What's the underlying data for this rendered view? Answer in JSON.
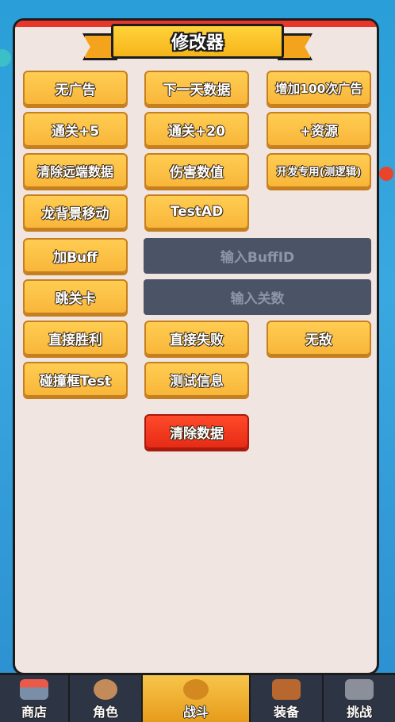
{
  "title": "修改器",
  "buttons": {
    "no_ads": "无广告",
    "next_day_data": "下一天数据",
    "add_100_ads": "增加100次广告",
    "pass_plus_5": "通关+5",
    "pass_plus_20": "通关+20",
    "add_resources": "+资源",
    "clear_remote_data": "清除远端数据",
    "damage_values": "伤害数值",
    "dev_only": "开发专用(测逻辑)",
    "dragon_bg_move": "龙背景移动",
    "test_ad": "TestAD",
    "add_buff": "加Buff",
    "skip_level": "跳关卡",
    "direct_win": "直接胜利",
    "direct_fail": "直接失败",
    "invincible": "无敌",
    "collision_box_test": "碰撞框Test",
    "test_info": "测试信息",
    "clear_data": "清除数据"
  },
  "inputs": {
    "buff_id_placeholder": "输入BuffID",
    "level_placeholder": "输入关数"
  },
  "nav": {
    "shop": "商店",
    "role": "角色",
    "battle": "战斗",
    "equip": "装备",
    "challenge": "挑战"
  },
  "colors": {
    "accent_orange": "#f8b63a",
    "danger_red": "#e62b16",
    "panel_bg": "#f1e5e2",
    "input_bg": "#4b5467"
  }
}
